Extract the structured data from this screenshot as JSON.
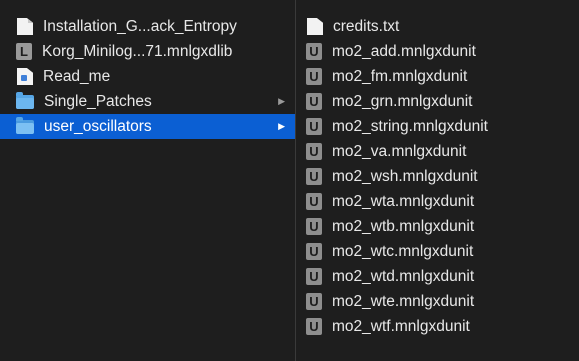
{
  "left_column": {
    "items": [
      {
        "label": "Installation_G...ack_Entropy",
        "icon": "document-icon",
        "chevron": ""
      },
      {
        "label": "Korg_Minilog...71.mnlgxdlib",
        "icon": "library-L-icon",
        "chevron": ""
      },
      {
        "label": "Read_me",
        "icon": "readme-document-icon",
        "chevron": ""
      },
      {
        "label": "Single_Patches",
        "icon": "folder-icon",
        "chevron": "▶"
      },
      {
        "label": "user_oscillators",
        "icon": "folder-icon",
        "chevron": "▶",
        "selected": true
      }
    ]
  },
  "right_column": {
    "items": [
      {
        "label": "credits.txt",
        "icon": "text-document-icon"
      },
      {
        "label": "mo2_add.mnlgxdunit",
        "icon": "unit-U-icon"
      },
      {
        "label": "mo2_fm.mnlgxdunit",
        "icon": "unit-U-icon"
      },
      {
        "label": "mo2_grn.mnlgxdunit",
        "icon": "unit-U-icon"
      },
      {
        "label": "mo2_string.mnlgxdunit",
        "icon": "unit-U-icon"
      },
      {
        "label": "mo2_va.mnlgxdunit",
        "icon": "unit-U-icon"
      },
      {
        "label": "mo2_wsh.mnlgxdunit",
        "icon": "unit-U-icon"
      },
      {
        "label": "mo2_wta.mnlgxdunit",
        "icon": "unit-U-icon"
      },
      {
        "label": "mo2_wtb.mnlgxdunit",
        "icon": "unit-U-icon"
      },
      {
        "label": "mo2_wtc.mnlgxdunit",
        "icon": "unit-U-icon"
      },
      {
        "label": "mo2_wtd.mnlgxdunit",
        "icon": "unit-U-icon"
      },
      {
        "label": "mo2_wte.mnlgxdunit",
        "icon": "unit-U-icon"
      },
      {
        "label": "mo2_wtf.mnlgxdunit",
        "icon": "unit-U-icon"
      }
    ]
  },
  "icon_glyphs": {
    "library": "L",
    "unit": "U"
  },
  "colors": {
    "background": "#1e1e1e",
    "selection": "#0b5fd3",
    "folder": "#56a6e6",
    "text": "#e8e8e8"
  }
}
